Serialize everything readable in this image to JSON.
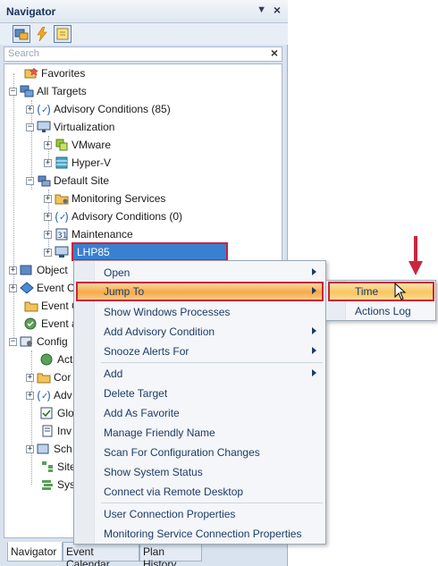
{
  "panel": {
    "title": "Navigator",
    "pin_icon": "pin-icon",
    "close_icon": "close-icon"
  },
  "toolbar": {
    "buttons": [
      {
        "icon": "targets-icon"
      },
      {
        "icon": "lightning-icon"
      },
      {
        "icon": "note-icon"
      }
    ]
  },
  "search": {
    "placeholder": "Search"
  },
  "tree": {
    "items": [
      {
        "label": "Favorites"
      },
      {
        "label": "All Targets"
      },
      {
        "label": "Advisory Conditions (85)"
      },
      {
        "label": "Virtualization"
      },
      {
        "label": "VMware"
      },
      {
        "label": "Hyper-V"
      },
      {
        "label": "Default Site"
      },
      {
        "label": "Monitoring Services"
      },
      {
        "label": "Advisory Conditions (0)"
      },
      {
        "label": "Maintenance"
      },
      {
        "label": "LHP85"
      },
      {
        "label": "Object"
      },
      {
        "label": "Event C"
      },
      {
        "label": "Event C"
      },
      {
        "label": "Event a"
      },
      {
        "label": "Config"
      },
      {
        "label": "Act"
      },
      {
        "label": "Cor"
      },
      {
        "label": "Adv"
      },
      {
        "label": "Glo"
      },
      {
        "label": "Inv"
      },
      {
        "label": "Sch"
      },
      {
        "label": "Site"
      },
      {
        "label": "Sys"
      }
    ]
  },
  "context_menu": {
    "items": [
      {
        "label": "Open"
      },
      {
        "label": "Jump To"
      },
      {
        "label": "Show Windows Processes"
      },
      {
        "label": "Add Advisory Condition"
      },
      {
        "label": "Snooze Alerts For"
      },
      {
        "label": "Add"
      },
      {
        "label": "Delete Target"
      },
      {
        "label": "Add As Favorite"
      },
      {
        "label": "Manage Friendly Name"
      },
      {
        "label": "Scan For Configuration Changes"
      },
      {
        "label": "Show System Status"
      },
      {
        "label": "Connect via Remote Desktop"
      },
      {
        "label": "User Connection Properties"
      },
      {
        "label": "Monitoring Service Connection Properties"
      }
    ]
  },
  "submenu": {
    "items": [
      {
        "label": "Time"
      },
      {
        "label": "Actions Log"
      }
    ]
  },
  "tabs": [
    {
      "label": "Navigator"
    },
    {
      "label": "Event Calendar"
    },
    {
      "label": "Plan History"
    }
  ],
  "colors": {
    "highlight_border": "#c8263d",
    "selection": "#3a80d0",
    "menu_highlight": "#f6a94a"
  }
}
